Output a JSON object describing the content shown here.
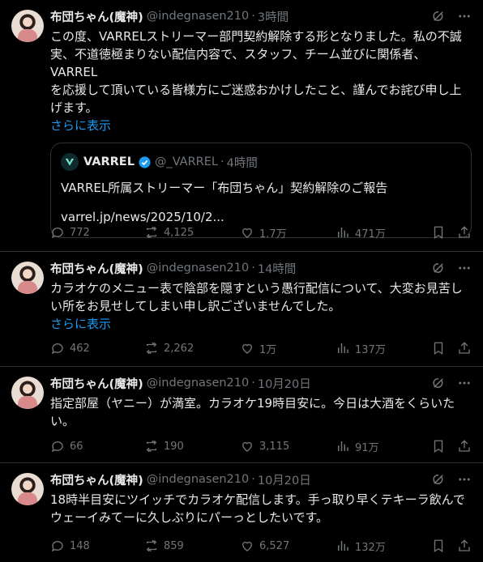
{
  "tweets": [
    {
      "name": "布団ちゃん(魔神)",
      "handle": "@indegnasen210",
      "sep": "·",
      "time": "3時間",
      "text": "この度、VARRELストリーマー部門契約解除する形となりました。私の不誠実、不道徳極まりない配信内容で、スタッフ、チーム並びに関係者、VARREL\nを応援して頂いている皆様方にご迷惑おかけしたこと、謹んでお詫び申し上\nげます。",
      "more": "さらに表示",
      "quote": {
        "name": "VARREL",
        "handle": "@_VARREL",
        "sep": "·",
        "time": "4時間",
        "text": "VARREL所属ストリーマー「布団ちゃん」契約解除のご報告",
        "link": "varrel.jp/news/2025/10/2..."
      },
      "replies": "772",
      "retweets": "4,125",
      "likes": "1.7万",
      "views": "471万"
    },
    {
      "name": "布団ちゃん(魔神)",
      "handle": "@indegnasen210",
      "sep": "·",
      "time": "14時間",
      "text": "カラオケのメニュー表で陰部を隠すという愚行配信について、大変お見苦し\nい所をお見せしてしまい申し訳ございませんでした。",
      "more": "さらに表示",
      "replies": "462",
      "retweets": "2,262",
      "likes": "1万",
      "views": "137万"
    },
    {
      "name": "布団ちゃん(魔神)",
      "handle": "@indegnasen210",
      "sep": "·",
      "time": "10月20日",
      "text": "指定部屋（ヤニー）が満室。カラオケ19時目安に。今日は大酒をくらいた\nい。",
      "replies": "66",
      "retweets": "190",
      "likes": "3,115",
      "views": "91万"
    },
    {
      "name": "布団ちゃん(魔神)",
      "handle": "@indegnasen210",
      "sep": "·",
      "time": "10月20日",
      "text": "18時半目安にツイッチでカラオケ配信します。手っ取り早くテキーラ飲んで\nウェーイみてーに久しぶりにパーっとしたいです。",
      "replies": "148",
      "retweets": "859",
      "likes": "6,527",
      "views": "132万"
    }
  ],
  "colors": {
    "background": "#000000",
    "text": "#e7e9ea",
    "muted": "#71767b",
    "link": "#1d9bf0",
    "border": "#2f3336",
    "verified": "#1d9bf0"
  },
  "icons": [
    "grok-icon",
    "more-icon",
    "reply-icon",
    "retweet-icon",
    "like-icon",
    "views-icon",
    "bookmark-icon",
    "share-icon",
    "verified-badge-icon",
    "varrel-logo-icon"
  ]
}
